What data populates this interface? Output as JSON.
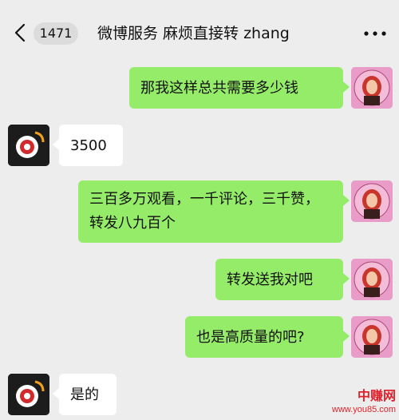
{
  "header": {
    "badge_count": "1471",
    "title": "微博服务 麻烦直接转 zhang",
    "back_icon": "chevron-left-icon",
    "more_icon": "ellipsis-icon"
  },
  "messages": [
    {
      "sender": "me",
      "text": "那我这样总共需要多少钱"
    },
    {
      "sender": "other",
      "text": "3500"
    },
    {
      "sender": "me",
      "text": "三百多万观看，一千评论，三千赞，转发八九百个"
    },
    {
      "sender": "me",
      "text": "转发送我对吧"
    },
    {
      "sender": "me",
      "text": "也是高质量的吧?"
    },
    {
      "sender": "other",
      "text": "是的"
    }
  ],
  "watermark": {
    "main": "中赚网",
    "url": "www.you85.com"
  },
  "colors": {
    "background": "#ededed",
    "my_bubble": "#95ec69",
    "their_bubble": "#ffffff",
    "watermark": "#e0202a"
  }
}
